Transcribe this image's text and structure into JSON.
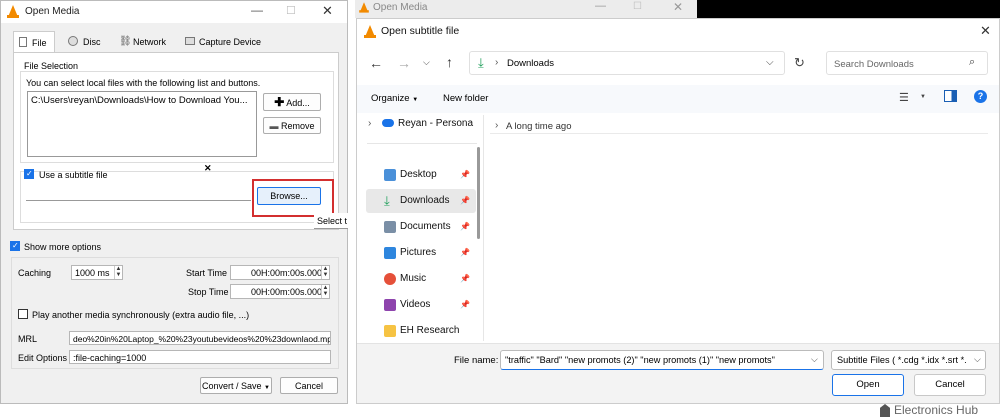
{
  "open_media": {
    "title": "Open Media",
    "tabs": [
      "File",
      "Disc",
      "Network",
      "Capture Device"
    ],
    "file_selection_label": "File Selection",
    "file_selection_hint": "You can select local files with the following list and buttons.",
    "file_path": "C:\\Users\\reyan\\Downloads\\How to Download You...",
    "add_label": "Add...",
    "remove_label": "Remove",
    "use_subtitle_label": "Use a subtitle file",
    "browse_label": "Browse...",
    "tooltip_text": "Select t",
    "show_more_label": "Show more options",
    "caching_label": "Caching",
    "caching_value": "1000 ms",
    "start_time_label": "Start Time",
    "start_time_value": "00H:00m:00s.000",
    "stop_time_label": "Stop Time",
    "stop_time_value": "00H:00m:00s.000",
    "play_another_label": "Play another media synchronously (extra audio file, ...)",
    "mrl_label": "MRL",
    "mrl_value": "deo%20in%20Laptop_%20%23youtubevideos%20%23downlaod.mp4",
    "edit_options_label": "Edit Options",
    "edit_options_value": ":file-caching=1000",
    "convert_label": "Convert / Save",
    "cancel_label": "Cancel"
  },
  "bg_window": {
    "title": "Open Media"
  },
  "subtitle_dialog": {
    "title": "Open subtitle file",
    "breadcrumb": "Downloads",
    "search_placeholder": "Search Downloads",
    "organize_label": "Organize",
    "new_folder_label": "New folder",
    "nav_items": [
      {
        "label": "Reyan - Persona",
        "icon": "cloud-icon"
      },
      {
        "label": "Desktop",
        "icon": "desktop-icon"
      },
      {
        "label": "Downloads",
        "icon": "download-icon"
      },
      {
        "label": "Documents",
        "icon": "documents-icon"
      },
      {
        "label": "Pictures",
        "icon": "pictures-icon"
      },
      {
        "label": "Music",
        "icon": "music-icon"
      },
      {
        "label": "Videos",
        "icon": "videos-icon"
      },
      {
        "label": "EH Research Wc",
        "icon": "folder-icon"
      }
    ],
    "group_header": "A long time ago",
    "file_name_label": "File name:",
    "file_name_value": "\"traffic\" \"Bard\" \"new promots (2)\" \"new promots (1)\" \"new promots\"",
    "filter_value": "Subtitle Files ( *.cdg *.idx *.srt *.",
    "open_label": "Open",
    "cancel_label": "Cancel"
  },
  "watermark": "Electronics Hub",
  "colors": {
    "accent": "#1a73e8",
    "highlight_box": "#d32f2f",
    "vlc_orange": "#f28a00"
  }
}
